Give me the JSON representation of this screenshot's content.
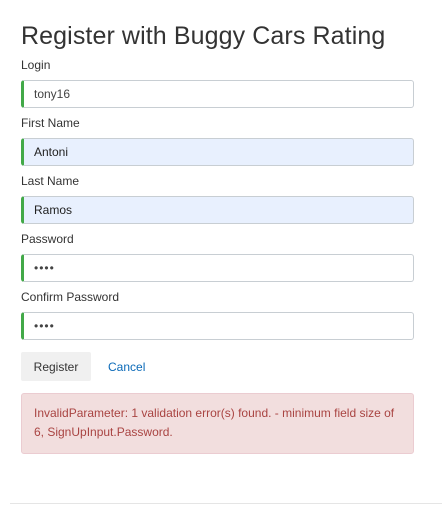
{
  "page": {
    "title": "Register with Buggy Cars Rating"
  },
  "form": {
    "login": {
      "label": "Login",
      "value": "tony16"
    },
    "first_name": {
      "label": "First Name",
      "value": "Antoni"
    },
    "last_name": {
      "label": "Last Name",
      "value": "Ramos"
    },
    "password": {
      "label": "Password",
      "value": "••••"
    },
    "confirm_password": {
      "label": "Confirm Password",
      "value": "••••"
    }
  },
  "actions": {
    "register_label": "Register",
    "cancel_label": "Cancel"
  },
  "error": {
    "message": "InvalidParameter: 1 validation error(s) found. - minimum field size of 6, SignUpInput.Password."
  },
  "colors": {
    "valid_border": "#42a948",
    "autofill_bg": "#e8f0fe",
    "error_bg": "#f2dede",
    "error_text": "#a94442",
    "link": "#0b6ab8"
  }
}
